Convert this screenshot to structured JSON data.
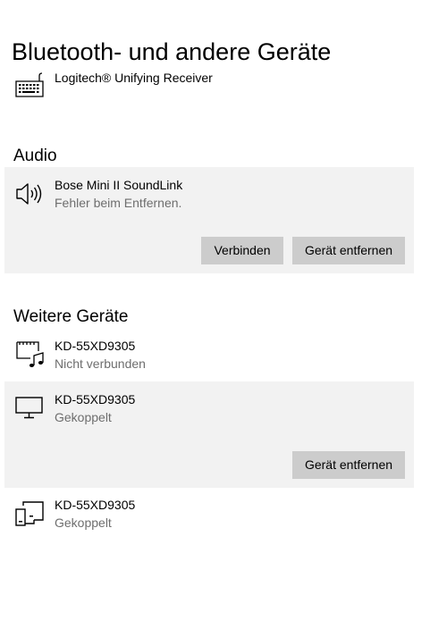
{
  "page": {
    "title": "Bluetooth- und andere Geräte"
  },
  "top_partial_device": {
    "name": "Logitech® Unifying Receiver",
    "icon": "keyboard-icon"
  },
  "audio": {
    "heading": "Audio",
    "devices": [
      {
        "name": "Bose Mini II SoundLink",
        "status": "Fehler beim Entfernen.",
        "icon": "speaker-icon",
        "selected": true,
        "connect_label": "Verbinden",
        "remove_label": "Gerät entfernen"
      }
    ]
  },
  "other_devices": {
    "heading": "Weitere Geräte",
    "devices": [
      {
        "name": "KD-55XD9305",
        "status": "Nicht verbunden",
        "icon": "media-device-icon"
      },
      {
        "name": "KD-55XD9305",
        "status": "Gekoppelt",
        "icon": "monitor-icon",
        "selected": true,
        "remove_label": "Gerät entfernen"
      },
      {
        "name": "KD-55XD9305",
        "status": "Gekoppelt",
        "icon": "devices-icon"
      }
    ]
  },
  "colors": {
    "selected_background": "#f2f2f2",
    "button_background": "#cccccc",
    "secondary_text": "#6e6e6e"
  }
}
